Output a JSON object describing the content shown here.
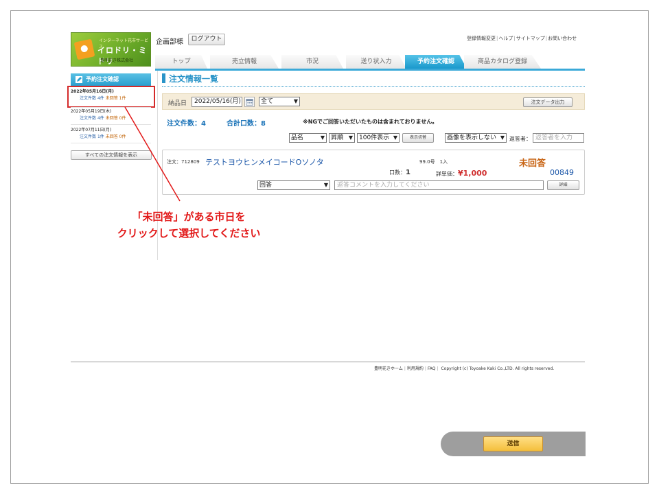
{
  "header": {
    "logo_tagline": "インターネット花市サービス",
    "logo_mark": "イロドリ・ミドリ",
    "logo_company": "豊明花き株式会社",
    "user_name": "企画部様",
    "logout_label": "ログアウト",
    "links": [
      "登録情報変更",
      "ヘルプ",
      "サイトマップ",
      "お問い合わせ"
    ]
  },
  "nav": {
    "tabs": [
      "トップ",
      "売立情報",
      "市況",
      "送り状入力",
      "予約注文確認",
      "商品カタログ登録"
    ],
    "active_tab": "予約注文確認"
  },
  "sidebar": {
    "title": "予約注文確認",
    "entries": [
      {
        "date": "2022年05月16日(月)",
        "orders_label": "注文件数",
        "orders": "4件",
        "unanswered_label": "未回答",
        "unanswered": "1件"
      },
      {
        "date": "2022年05月19日(木)",
        "orders_label": "注文件数",
        "orders": "4件",
        "unanswered_label": "未回答",
        "unanswered": "0件"
      },
      {
        "date": "2022年07月11日(月)",
        "orders_label": "注文件数",
        "orders": "1件",
        "unanswered_label": "未回答",
        "unanswered": "0件"
      }
    ],
    "all_orders_label": "すべての注文情報を表示"
  },
  "main": {
    "title": "注文情報一覧",
    "filter": {
      "date_label": "納品日",
      "date_value": "2022/05/16(月)",
      "range_value": "全て",
      "export_label": "注文データ出力"
    },
    "summary": {
      "order_count": "注文件数：4",
      "total_units": "合計口数：8",
      "note": "※NGでご回答いただいたものは含まれておりません。"
    },
    "controls": {
      "sort_field": "品名",
      "sort_order": "昇順",
      "page_size": "100件表示",
      "toggle_label": "表示切替",
      "image_option": "画像を表示しない",
      "answerer_label": "返答者：",
      "answerer_placeholder": "返答者を入力"
    },
    "order": {
      "order_no": "注文：712809",
      "product": "テストヨウヒンメイコードOソノタ",
      "size": "99.0号",
      "qty": "1入",
      "status": "未回答",
      "units_label": "口数：",
      "units": "1",
      "price_label": "詳単価：",
      "price": "¥1,000",
      "code": "00849",
      "answer_value": "回答",
      "comment_placeholder": "返答コメントを入力してください",
      "detail_label": "詳細"
    }
  },
  "annotation": {
    "line1": "「未回答」がある市日を",
    "line2": "クリックして選択してください"
  },
  "footer": {
    "links": [
      "豊明花きホーム",
      "利用規約",
      "FAQ"
    ],
    "copyright": "Copyright (c) Toyoake Kaki Co.,LTD. All rights reserved."
  },
  "submit": {
    "label": "送信"
  },
  "colors": {
    "accent": "#2a94c8",
    "annotation": "#e21818",
    "status": "#c86414",
    "price": "#d03030"
  }
}
